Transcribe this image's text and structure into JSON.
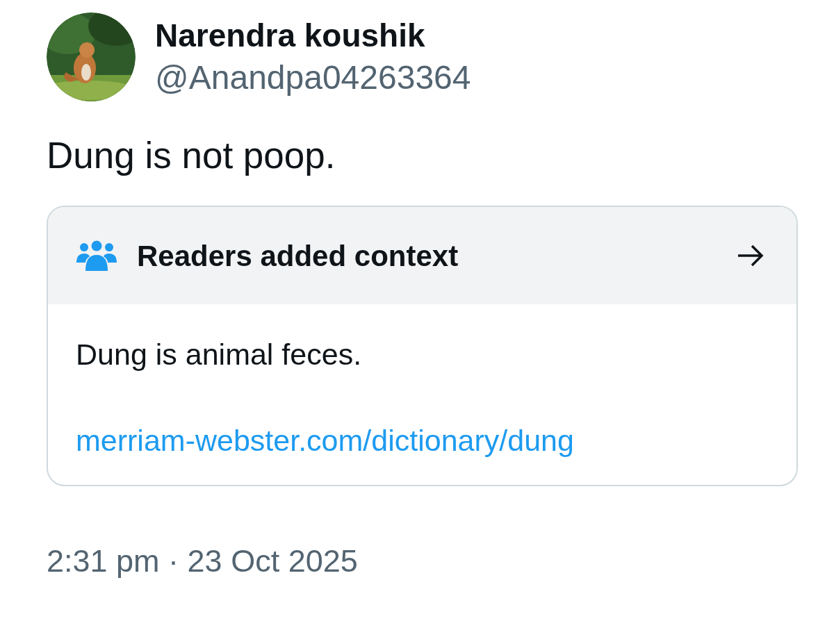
{
  "author": {
    "name": "Narendra koushik",
    "handle": "@Anandpa04263364"
  },
  "text": "Dung is not poop.",
  "context_note": {
    "title": "Readers added context",
    "body": "Dung is animal feces.",
    "link": "merriam-webster.com/dictionary/dung"
  },
  "timestamp": "2:31 pm · 23 Oct 2025"
}
